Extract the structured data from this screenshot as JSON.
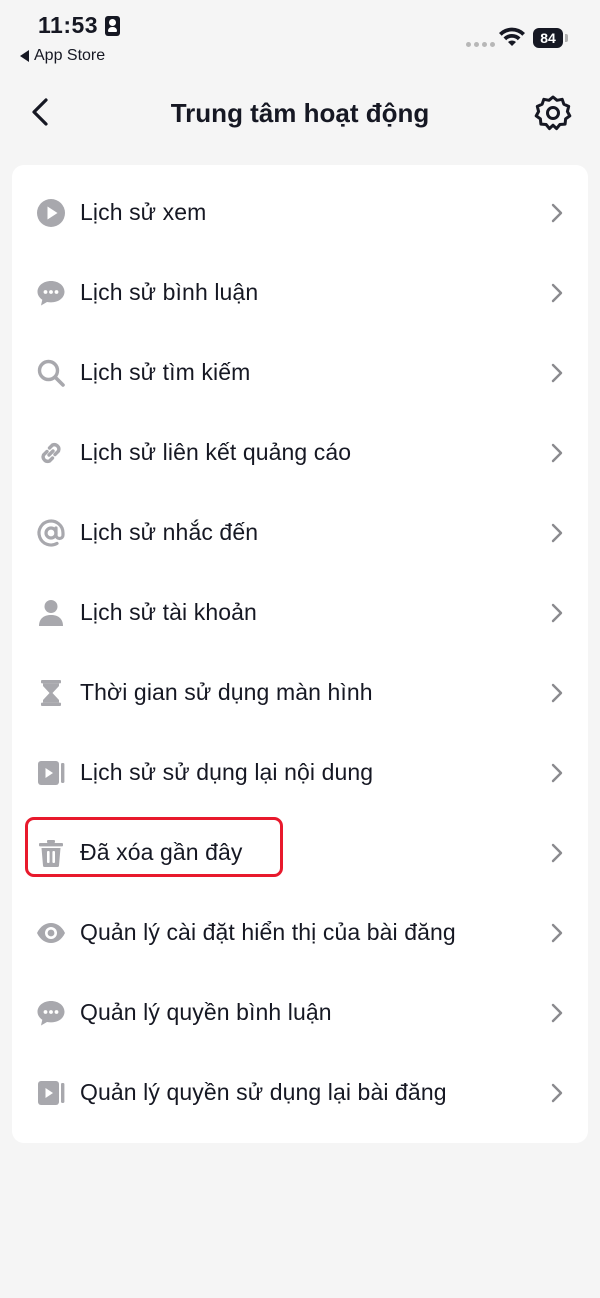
{
  "status_bar": {
    "time": "11:53",
    "back_app": "App Store",
    "battery": "84"
  },
  "header": {
    "title": "Trung tâm hoạt động"
  },
  "menu": {
    "items": [
      {
        "label": "Lịch sử xem",
        "icon": "play-circle-icon"
      },
      {
        "label": "Lịch sử bình luận",
        "icon": "comment-icon"
      },
      {
        "label": "Lịch sử tìm kiếm",
        "icon": "search-icon"
      },
      {
        "label": "Lịch sử liên kết quảng cáo",
        "icon": "link-icon"
      },
      {
        "label": "Lịch sử nhắc đến",
        "icon": "at-icon"
      },
      {
        "label": "Lịch sử tài khoản",
        "icon": "person-icon"
      },
      {
        "label": "Thời gian sử dụng màn hình",
        "icon": "hourglass-icon"
      },
      {
        "label": "Lịch sử sử dụng lại nội dung",
        "icon": "reuse-video-icon"
      },
      {
        "label": "Đã xóa gần đây",
        "icon": "trash-icon"
      },
      {
        "label": "Quản lý cài đặt hiển thị của bài đăng",
        "icon": "eye-icon"
      },
      {
        "label": "Quản lý quyền bình luận",
        "icon": "comment-icon"
      },
      {
        "label": "Quản lý quyền sử dụng lại bài đăng",
        "icon": "reuse-video-icon"
      }
    ]
  },
  "colors": {
    "icon_gray": "#a8a8ad",
    "highlight_red": "#e8192c",
    "text": "#161823"
  }
}
